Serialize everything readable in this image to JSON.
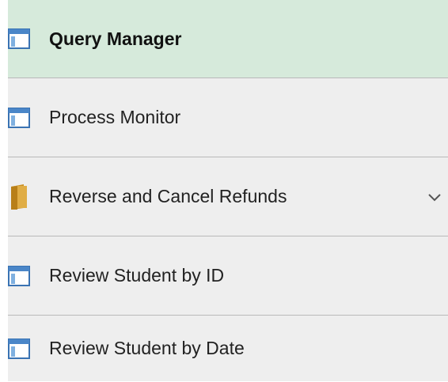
{
  "menu": {
    "items": [
      {
        "label": "Query Manager",
        "icon": "page-window-icon",
        "active": true
      },
      {
        "label": "Process Monitor",
        "icon": "page-window-icon",
        "active": false
      },
      {
        "label": "Reverse and Cancel Refunds",
        "icon": "folder-icon",
        "active": false,
        "expandable": true,
        "expand_icon": "chevron-down-icon"
      },
      {
        "label": "Review Student by ID",
        "icon": "page-window-icon",
        "active": false
      },
      {
        "label": "Review Student by Date",
        "icon": "page-window-icon",
        "active": false
      }
    ]
  },
  "colors": {
    "active_background": "#d6eadb",
    "item_background": "#eeeeee",
    "divider": "#b9b9b9",
    "window_icon_blue": "#4a86c8",
    "folder_icon_gold": "#d9a53a"
  }
}
